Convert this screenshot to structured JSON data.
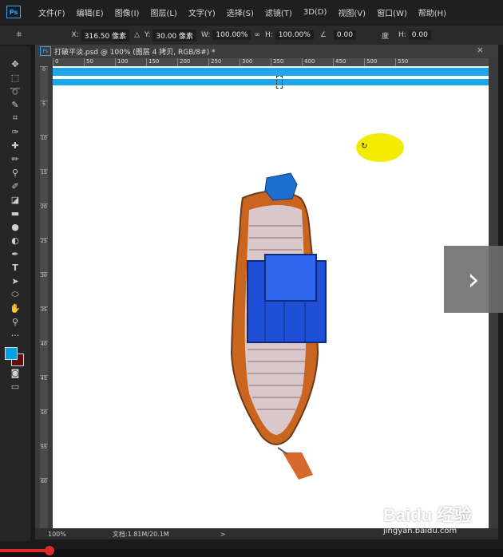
{
  "menubar": {
    "logo": "Ps",
    "items": [
      "文件(F)",
      "编辑(E)",
      "图像(I)",
      "图层(L)",
      "文字(Y)",
      "选择(S)",
      "滤镜(T)",
      "3D(D)",
      "视图(V)",
      "窗口(W)",
      "帮助(H)"
    ]
  },
  "options": {
    "x_label": "X:",
    "x_value": "316.50 像素",
    "y_label": "Y:",
    "y_value": "30.00 像素",
    "w_label": "W:",
    "w_value": "100.00%",
    "h_label": "H:",
    "h_value": "100.00%",
    "angle_value": "0.00",
    "angle_unit": "度",
    "h2_label": "H:",
    "h2_value": "0.00"
  },
  "document": {
    "tab_logo": "Ps",
    "tab_title": "打破平淡.psd @ 100% (图层 4 拷贝, RGB/8#) *",
    "close": "×",
    "ruler_top": [
      "0",
      "50",
      "100",
      "150",
      "200",
      "250",
      "300",
      "350",
      "400",
      "450",
      "500",
      "550"
    ],
    "ruler_left": [
      "0",
      "5",
      "10",
      "15",
      "20",
      "25",
      "30",
      "35",
      "40",
      "45",
      "50",
      "55",
      "60",
      "65"
    ]
  },
  "status": {
    "zoom": "100%",
    "doc_info": "文档:1.81M/20.1M",
    "arrow": ">"
  },
  "overlay": {
    "next_arrow": "›",
    "watermark": "Baidu 经验",
    "watermark_sub": "jingyan.baidu.com"
  },
  "colors": {
    "foreground": "#00a3e8",
    "background": "#5a0f0f",
    "stripe": "#1ea7e8"
  }
}
